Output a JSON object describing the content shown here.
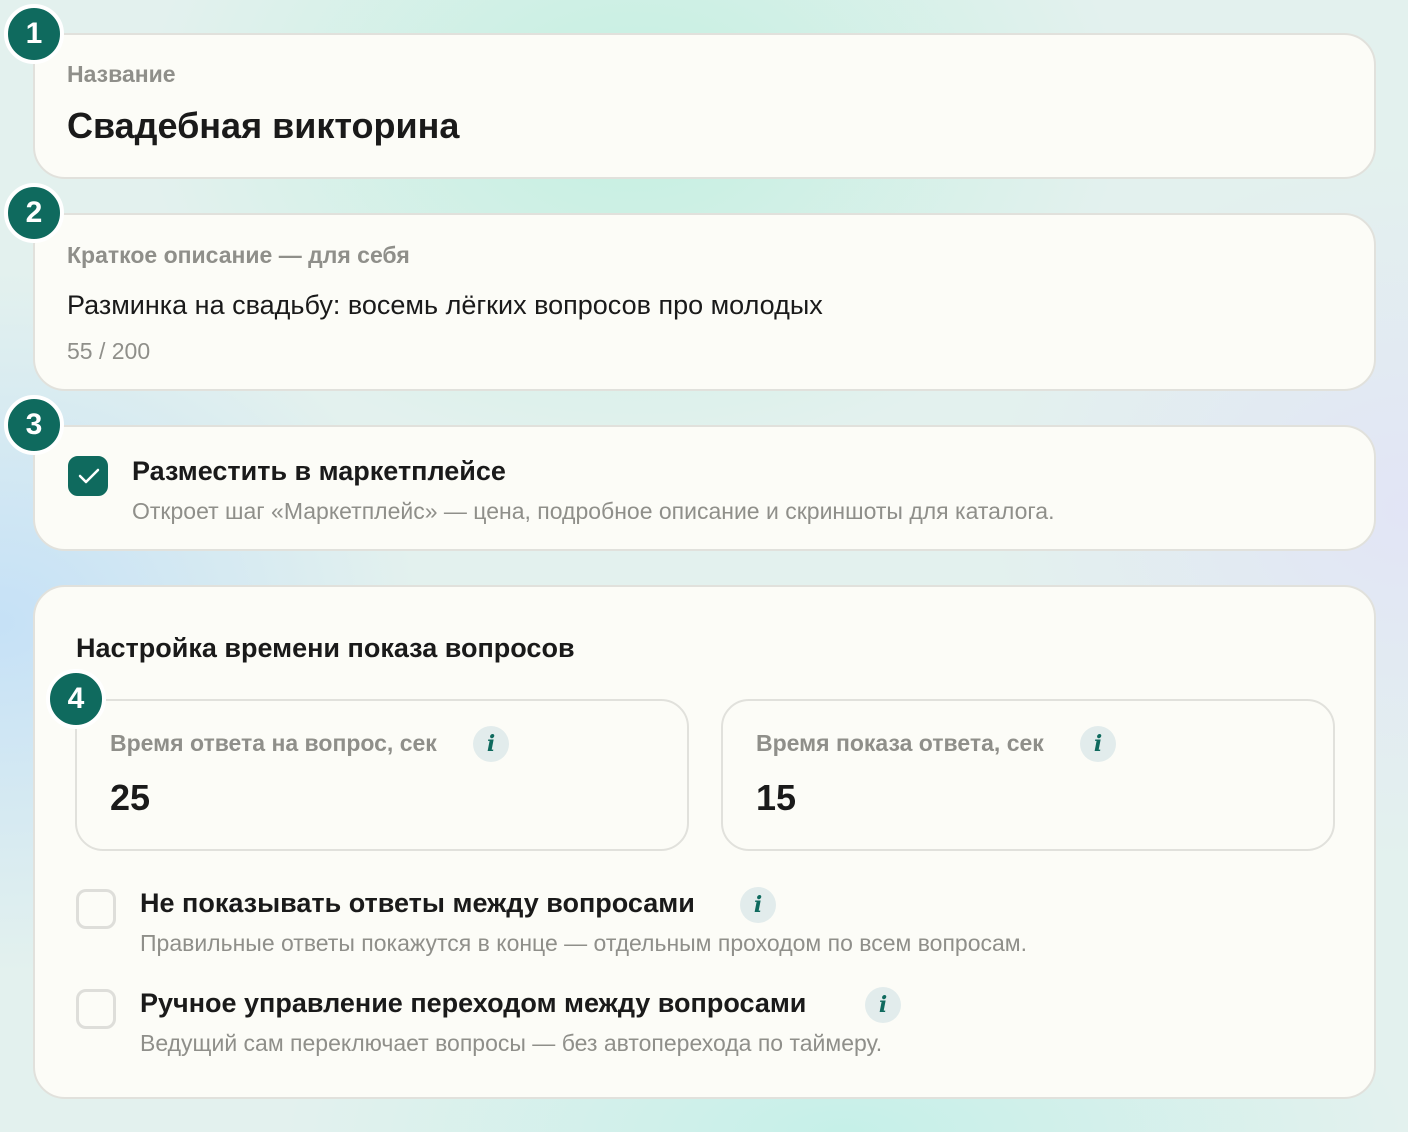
{
  "name_section": {
    "step": "1",
    "label": "Название",
    "value": "Свадебная викторина"
  },
  "description_section": {
    "step": "2",
    "label": "Краткое описание — для себя",
    "value": "Разминка на свадьбу: восемь лёгких вопросов про молодых",
    "counter": "55 / 200"
  },
  "marketplace_section": {
    "step": "3",
    "checked": true,
    "title": "Разместить в маркетплейсе",
    "description": "Откроет шаг «Маркетплейс» — цена, подробное описание и скриншоты для каталога."
  },
  "timing_section": {
    "heading": "Настройка времени показа вопросов",
    "step": "4",
    "answer_time": {
      "label": "Время ответа на вопрос, сек",
      "value": "25",
      "info_icon": "i"
    },
    "reveal_time": {
      "label": "Время показа ответа, сек",
      "value": "15",
      "info_icon": "i"
    },
    "options": [
      {
        "checked": false,
        "title": "Не показывать ответы между вопросами",
        "description": "Правильные ответы покажутся в конце — отдельным проходом по всем вопросам.",
        "info_icon": "i"
      },
      {
        "checked": false,
        "title": "Ручное управление переходом между вопросами",
        "description": "Ведущий сам переключает вопросы — без автоперехода по таймеру.",
        "info_icon": "i"
      }
    ]
  },
  "colors": {
    "accent": "#0f6a5e",
    "card_background": "#fcfcf7",
    "muted_text": "#8f8f8a",
    "card_border": "#e1e1dc"
  }
}
